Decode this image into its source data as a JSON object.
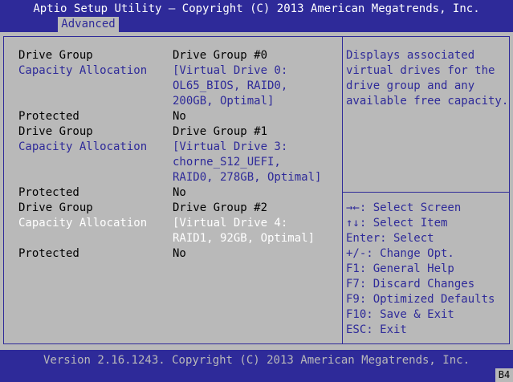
{
  "header": {
    "title": "Aptio Setup Utility – Copyright (C) 2013 American Megatrends, Inc.",
    "tab_advanced": "Advanced"
  },
  "settings": [
    {
      "label": "Drive Group",
      "value": [
        "Drive Group #0"
      ],
      "type": "static"
    },
    {
      "label": "Capacity Allocation",
      "value": [
        "[Virtual Drive 0:",
        "OL65_BIOS, RAID0,",
        "200GB, Optimal]"
      ],
      "type": "option"
    },
    {
      "label": "Protected",
      "value": [
        "No"
      ],
      "type": "static"
    },
    {
      "label": "Drive Group",
      "value": [
        "Drive Group #1"
      ],
      "type": "static"
    },
    {
      "label": "Capacity Allocation",
      "value": [
        "[Virtual Drive 3:",
        "chorne_S12_UEFI,",
        "RAID0, 278GB, Optimal]"
      ],
      "type": "option"
    },
    {
      "label": "Protected",
      "value": [
        "No"
      ],
      "type": "static"
    },
    {
      "label": "Drive Group",
      "value": [
        "Drive Group #2"
      ],
      "type": "static"
    },
    {
      "label": "Capacity Allocation",
      "value": [
        "[Virtual Drive 4:",
        "RAID1, 92GB, Optimal]"
      ],
      "type": "option-selected"
    },
    {
      "label": "Protected",
      "value": [
        "No"
      ],
      "type": "static"
    }
  ],
  "help": {
    "description": [
      "Displays associated",
      "virtual drives for the",
      "drive group and any",
      "available free capacity."
    ],
    "keys": [
      "→←: Select Screen",
      "↑↓: Select Item",
      "Enter: Select",
      "+/-: Change Opt.",
      "F1: General Help",
      "F7: Discard Changes",
      "F9: Optimized Defaults",
      "F10: Save & Exit",
      "ESC: Exit"
    ]
  },
  "footer": {
    "version": "Version 2.16.1243. Copyright (C) 2013 American Megatrends, Inc.",
    "code": "B4"
  }
}
